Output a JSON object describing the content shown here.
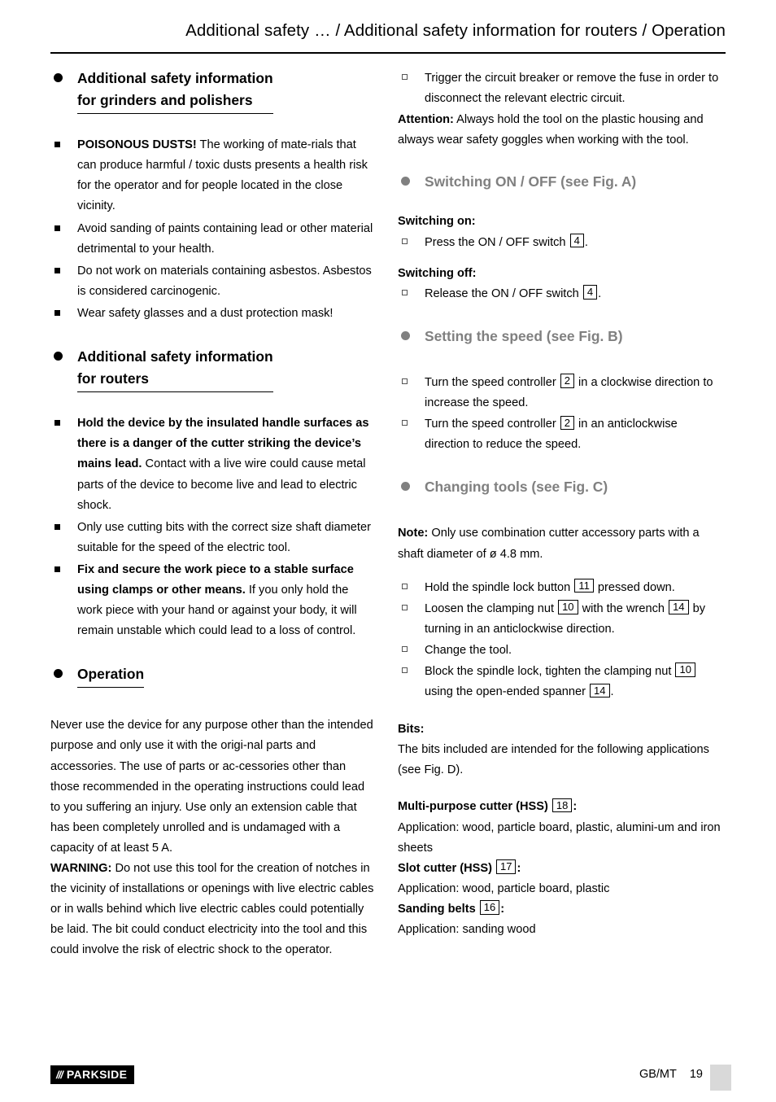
{
  "header": {
    "title": "Additional safety … / Additional safety information for routers / Operation"
  },
  "left": {
    "sec1": {
      "line1": "Additional safety information",
      "line2": "for grinders and polishers"
    },
    "sec1_items": [
      "POISONOUS DUSTS! The working of mate-rials that can produce harmful / toxic dusts presents a health risk for the operator and for people located in the close vicinity.",
      "Avoid sanding of paints containing lead or other material detrimental to your health.",
      "Do not work on materials containing asbestos. Asbestos is considered carcinogenic.",
      "Wear safety glasses and a dust protection mask!"
    ],
    "item1_bold": "POISONOUS DUSTS!",
    "item1_rest": " The working of mate-rials that can produce harmful / toxic dusts presents a health risk for the operator and for people located in the close vicinity.",
    "item2": "Avoid sanding of paints containing lead or other material detrimental to your health.",
    "item3": "Do not work on materials containing asbestos. Asbestos is considered carcinogenic.",
    "item4": "Wear safety glasses and a dust protection mask!",
    "sec2": {
      "line1": "Additional safety information",
      "line2": "for routers"
    },
    "r_item1_bold": "Hold the device by the insulated handle surfaces as there is a danger of the cutter striking the device’s mains lead.",
    "r_item1_rest": " Contact with a live wire could cause metal parts of the device to become live and lead to electric shock.",
    "r_item2": "Only use cutting bits with the correct size shaft diameter suitable for the speed of the electric tool.",
    "r_item3_bold": "Fix and secure the work piece to a stable surface using clamps or other means.",
    "r_item3_rest": " If you only hold the work piece with your hand or against your body, it will remain unstable which could lead to a loss of control.",
    "sec3": "Operation",
    "op_p1": "Never use the device for any purpose other than the intended purpose and only use it with the origi-nal parts and accessories. The use of parts or ac-cessories other than those recommended in the operating instructions could lead to you suffering an injury. Use only an extension cable that has been completely unrolled and is undamaged with a capacity of at least 5 A.",
    "op_warning_bold": "WARNING:",
    "op_warning_rest": " Do not use this tool for the creation of notches in the vicinity of installations or openings with live electric cables or in walls behind which live electric cables could potentially be laid. The bit could conduct electricity into the tool and this could involve the risk of electric shock to the operator."
  },
  "right": {
    "top_item": "Trigger the circuit breaker or remove the fuse in order to disconnect the relevant electric circuit.",
    "attention_bold": "Attention:",
    "attention_rest": " Always hold the tool on the plastic housing and always wear safety goggles when working with the tool.",
    "sec_switch": "Switching ON / OFF (see Fig. A)",
    "switch_on_label": "Switching on:",
    "switch_on_pre": "Press the ON / OFF switch ",
    "switch_on_num": "4",
    "switch_on_post": ".",
    "switch_off_label": "Switching off:",
    "switch_off_pre": "Release the ON / OFF switch ",
    "switch_off_num": "4",
    "switch_off_post": ".",
    "sec_speed": "Setting the speed (see Fig. B)",
    "speed_item1_pre": "Turn the speed controller ",
    "speed_item1_num": "2",
    "speed_item1_post": " in a clockwise direction to increase the speed.",
    "speed_item2_pre": "Turn the speed controller ",
    "speed_item2_num": "2",
    "speed_item2_post": " in an anticlockwise direction to reduce the speed.",
    "sec_tools": "Changing tools (see Fig. C)",
    "note_bold": "Note:",
    "note_rest": " Only use combination cutter accessory parts with a shaft diameter of ø 4.8 mm.",
    "tool_item1_pre": "Hold the spindle lock button ",
    "tool_item1_num": "11",
    "tool_item1_post": " pressed down.",
    "tool_item2_pre": "Loosen the clamping nut ",
    "tool_item2_num1": "10",
    "tool_item2_mid": " with the wrench ",
    "tool_item2_num2": "14",
    "tool_item2_post": " by turning in an anticlockwise direction.",
    "tool_item3": "Change the tool.",
    "tool_item4_pre": "Block the spindle lock, tighten the clamping nut ",
    "tool_item4_num1": "10",
    "tool_item4_mid": " using the open-ended spanner ",
    "tool_item4_num2": "14",
    "tool_item4_post": ".",
    "bits_label": "Bits:",
    "bits_text": "The bits included are intended for the following applications (see Fig. D).",
    "mp_label": "Multi-purpose cutter (HSS)",
    "mp_num": "18",
    "mp_colon": ":",
    "mp_app": "Application: wood, particle board, plastic, alumini-um and iron sheets",
    "slot_label": "Slot cutter (HSS)",
    "slot_num": "17",
    "slot_colon": ":",
    "slot_app": "Application: wood, particle board, plastic",
    "sand_label": "Sanding belts",
    "sand_num": "16",
    "sand_colon": ":",
    "sand_app": "Application: sanding wood"
  },
  "footer": {
    "brand": "PARKSIDE",
    "slashes": "///",
    "lang": "GB/MT",
    "page": "19"
  }
}
